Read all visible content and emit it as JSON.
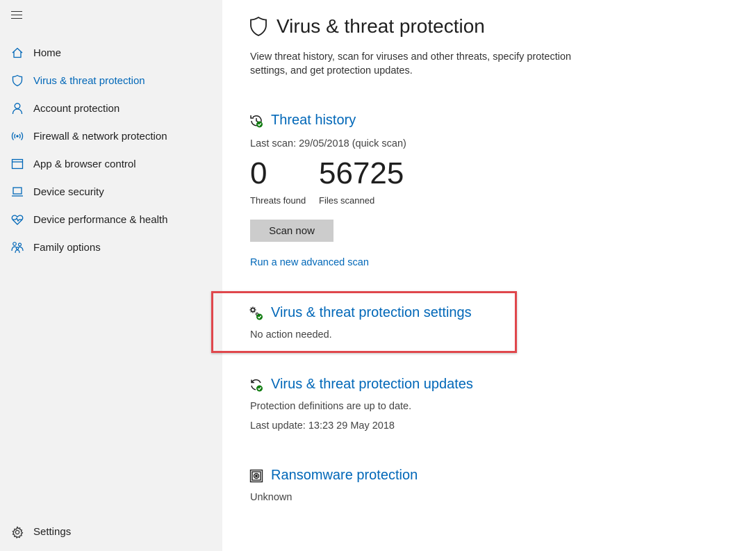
{
  "sidebar": {
    "items": [
      {
        "label": "Home",
        "icon": "home-icon"
      },
      {
        "label": "Virus & threat protection",
        "icon": "shield-icon",
        "active": true
      },
      {
        "label": "Account protection",
        "icon": "person-icon"
      },
      {
        "label": "Firewall & network protection",
        "icon": "wifi-icon"
      },
      {
        "label": "App & browser control",
        "icon": "window-icon"
      },
      {
        "label": "Device security",
        "icon": "laptop-icon"
      },
      {
        "label": "Device performance & health",
        "icon": "heart-icon"
      },
      {
        "label": "Family options",
        "icon": "family-icon"
      }
    ],
    "settings_label": "Settings"
  },
  "page": {
    "title": "Virus & threat protection",
    "description": "View threat history, scan for viruses and other threats, specify protection settings, and get protection updates."
  },
  "threat_history": {
    "title": "Threat history",
    "last_scan": "Last scan: 29/05/2018 (quick scan)",
    "threats_count": "0",
    "threats_label": "Threats found",
    "files_count": "56725",
    "files_label": "Files scanned",
    "scan_button": "Scan now",
    "advanced_link": "Run a new advanced scan"
  },
  "settings_section": {
    "title": "Virus & threat protection settings",
    "status": "No action needed."
  },
  "updates_section": {
    "title": "Virus & threat protection updates",
    "status": "Protection definitions are up to date.",
    "last_update": "Last update: 13:23 29 May 2018"
  },
  "ransomware_section": {
    "title": "Ransomware protection",
    "status": "Unknown"
  },
  "colors": {
    "accent": "#0067b8",
    "highlight": "#e0474c",
    "ok_green": "#107c10",
    "sidebar_bg": "#f2f2f2"
  }
}
